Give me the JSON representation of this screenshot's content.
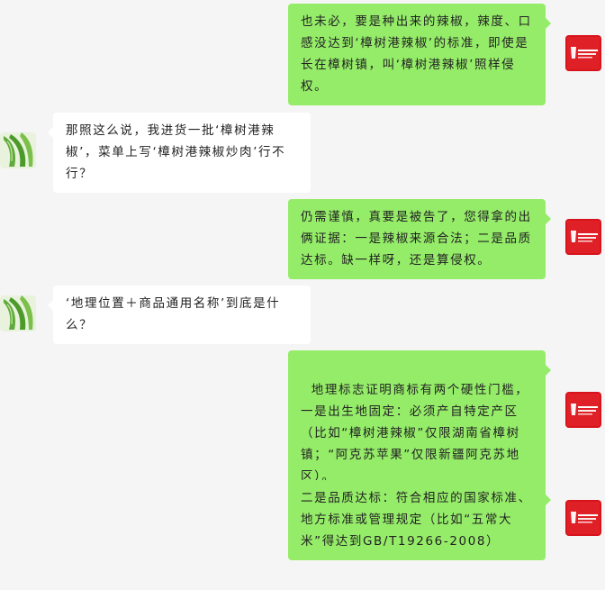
{
  "avatars": {
    "self_icon": "red-brand-logo-icon",
    "self_color": "#d7141b",
    "contact_icon": "green-chili-pepper-icon",
    "contact_color": "#5faa3a"
  },
  "colors": {
    "background": "#f5f5f5",
    "self_bubble": "#95ec69",
    "contact_bubble": "#ffffff"
  },
  "messages": [
    {
      "sender": "self",
      "text": "也未必，要是种出来的辣椒，辣度、口感没达到‘樟树港辣椒’的标准，即使是长在樟树镇，叫‘樟树港辣椒’照样侵权。"
    },
    {
      "sender": "contact",
      "text": "那照这么说，我进货一批‘樟树港辣椒’，菜单上写‘樟树港辣椒炒肉’行不行？"
    },
    {
      "sender": "self",
      "text": "仍需谨慎，真要是被告了，您得拿的出俩证据：一是辣椒来源合法；二是品质达标。缺一样呀，还是算侵权。"
    },
    {
      "sender": "contact",
      "text": "‘地理位置＋商品通用名称’到底是什么？"
    },
    {
      "sender": "self",
      "text": "地理标志证明商标有两个硬性门槛，\n一是出生地固定：必须产自特定产区（比如“樟树港辣椒”仅限湖南省樟树镇；“阿克苏苹果”仅限新疆阿克苏地区）。"
    },
    {
      "sender": "self",
      "text": "二是品质达标：符合相应的国家标准、地方标准或管理规定（比如“五常大米”得达到GB/T19266-2008）"
    }
  ]
}
